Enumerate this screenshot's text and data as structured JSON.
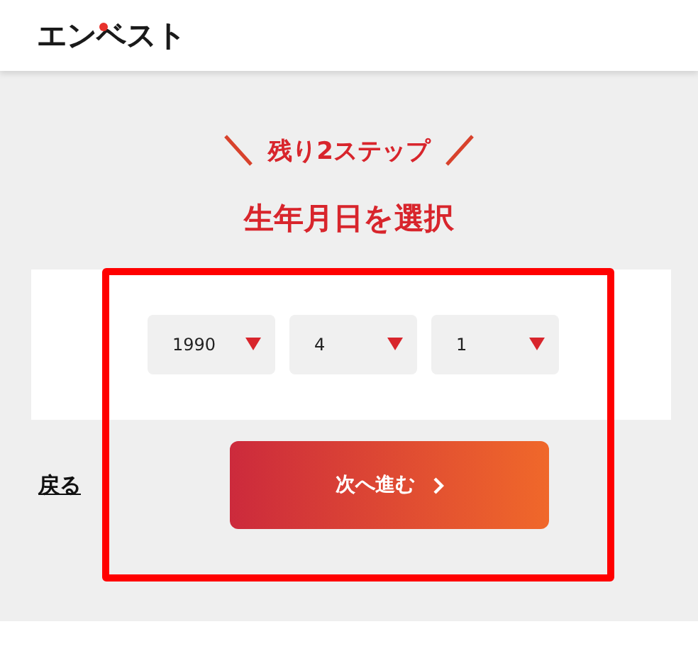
{
  "header": {
    "logo": "エンベスト"
  },
  "step": {
    "label": "残り2ステップ"
  },
  "title": "生年月日を選択",
  "selects": [
    {
      "value": "1990"
    },
    {
      "value": "4"
    },
    {
      "value": "1"
    }
  ],
  "back_link": "戻る",
  "next_button": "次へ進む"
}
